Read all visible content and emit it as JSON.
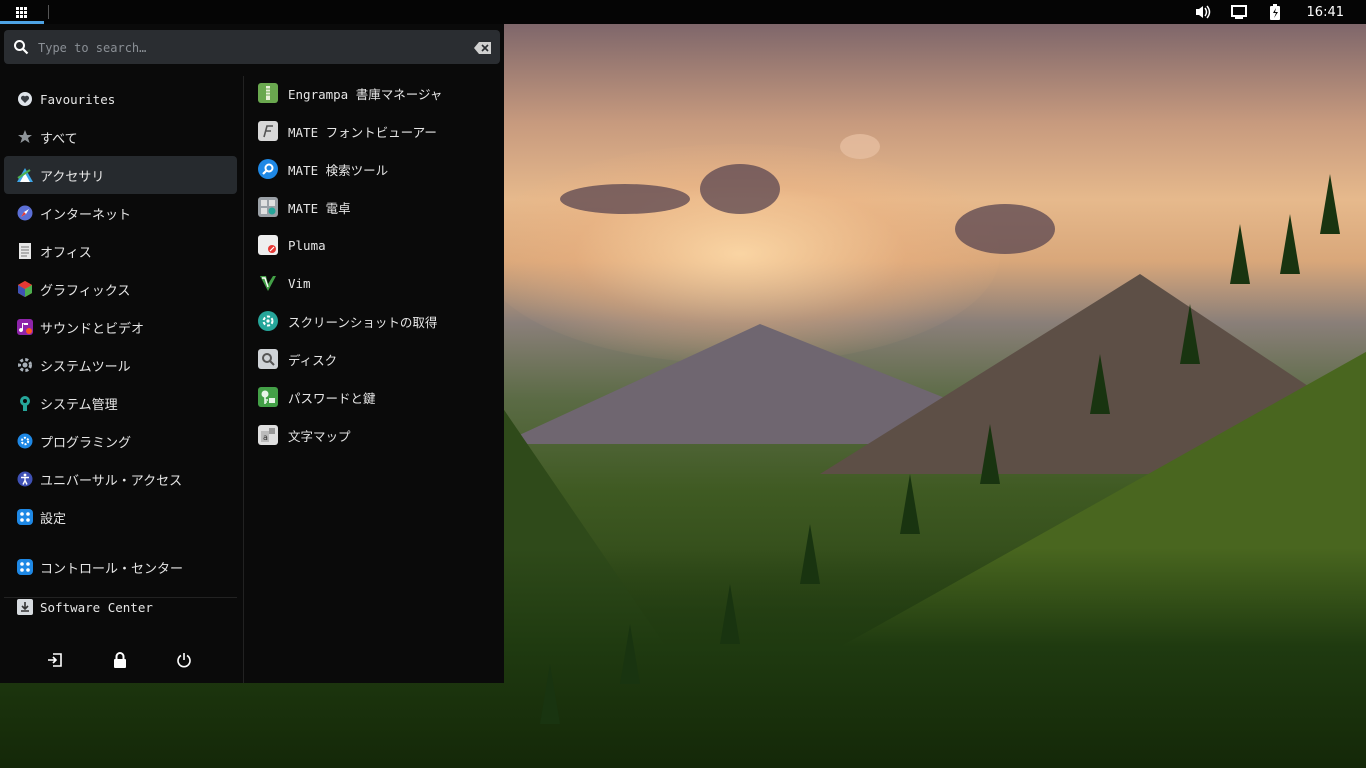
{
  "panel": {
    "menu_icon": "app-grid-icon",
    "tray_icons": [
      "volume-icon",
      "display-icon",
      "battery-icon"
    ],
    "clock": "16:41",
    "accent": "#4ea3e4"
  },
  "search": {
    "placeholder": "Type to search…",
    "value": ""
  },
  "categories": [
    {
      "label": "Favourites",
      "icon": "heart-icon"
    },
    {
      "label": "すべて",
      "icon": "star-icon"
    },
    {
      "label": "アクセサリ",
      "icon": "accessories-icon",
      "active": true
    },
    {
      "label": "インターネット",
      "icon": "internet-icon"
    },
    {
      "label": "オフィス",
      "icon": "office-icon"
    },
    {
      "label": "グラフィックス",
      "icon": "graphics-icon"
    },
    {
      "label": "サウンドとビデオ",
      "icon": "multimedia-icon"
    },
    {
      "label": "システムツール",
      "icon": "system-tools-icon"
    },
    {
      "label": "システム管理",
      "icon": "system-admin-icon"
    },
    {
      "label": "プログラミング",
      "icon": "programming-icon"
    },
    {
      "label": "ユニバーサル・アクセス",
      "icon": "accessibility-icon"
    },
    {
      "label": "設定",
      "icon": "settings-icon"
    }
  ],
  "extras": [
    {
      "label": "コントロール・センター",
      "icon": "control-center-icon"
    },
    {
      "label": "Software Center",
      "icon": "software-center-icon"
    }
  ],
  "power": [
    "logout-icon",
    "lock-icon",
    "power-icon"
  ],
  "apps": [
    {
      "label": "Engrampa 書庫マネージャ",
      "icon": "archive-manager-icon"
    },
    {
      "label": "MATE フォントビューアー",
      "icon": "font-viewer-icon"
    },
    {
      "label": "MATE 検索ツール",
      "icon": "search-tool-icon"
    },
    {
      "label": "MATE 電卓",
      "icon": "calculator-icon"
    },
    {
      "label": "Pluma",
      "icon": "text-editor-icon"
    },
    {
      "label": "Vim",
      "icon": "vim-icon"
    },
    {
      "label": "スクリーンショットの取得",
      "icon": "screenshot-icon"
    },
    {
      "label": "ディスク",
      "icon": "disk-icon"
    },
    {
      "label": "パスワードと鍵",
      "icon": "passwords-keys-icon"
    },
    {
      "label": "文字マップ",
      "icon": "character-map-icon"
    }
  ]
}
